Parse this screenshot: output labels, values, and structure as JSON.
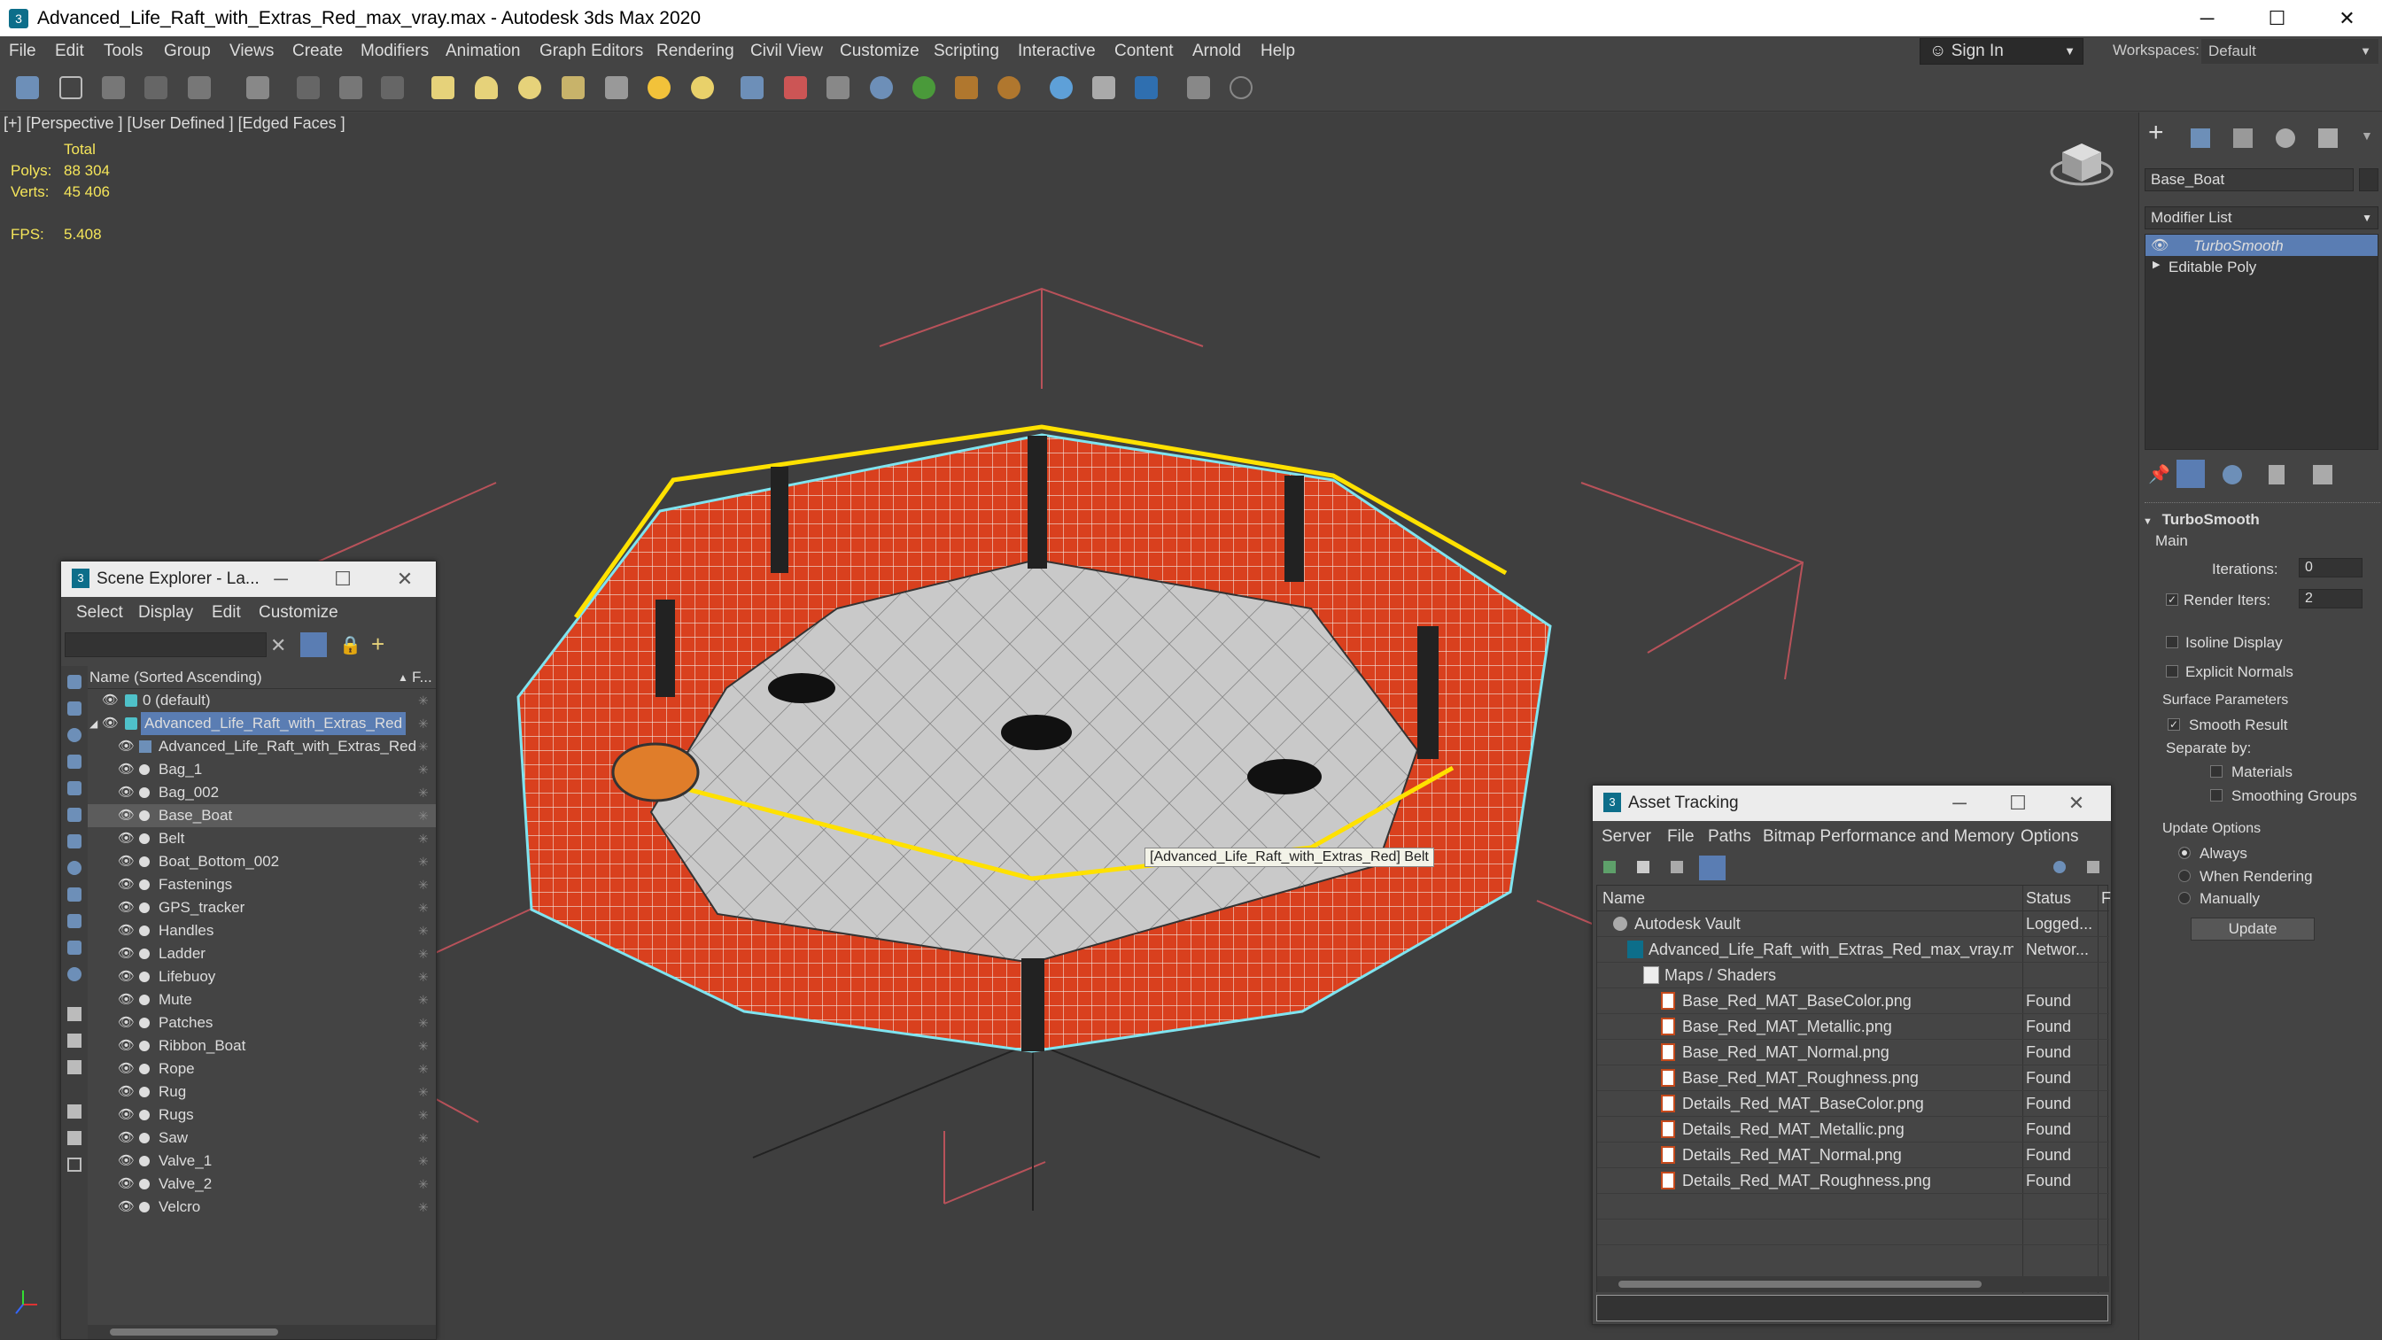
{
  "window": {
    "title": "Advanced_Life_Raft_with_Extras_Red_max_vray.max - Autodesk 3ds Max 2020",
    "minimize": "─",
    "maximize": "☐",
    "close": "✕"
  },
  "menu": [
    "File",
    "Edit",
    "Tools",
    "Group",
    "Views",
    "Create",
    "Modifiers",
    "Animation",
    "Graph Editors",
    "Rendering",
    "Civil View",
    "Customize",
    "Scripting",
    "Interactive",
    "Content",
    "Arnold",
    "Help"
  ],
  "signin": {
    "label": "Sign In",
    "arrow": "▼"
  },
  "workspaces": {
    "label": "Workspaces:",
    "value": "Default"
  },
  "viewport": {
    "label": "[+] [Perspective ] [User Defined ] [Edged Faces ]",
    "stats": {
      "total": "Total",
      "polys_label": "Polys:",
      "polys": "88 304",
      "verts_label": "Verts:",
      "verts": "45 406",
      "fps_label": "FPS:",
      "fps": "5.408"
    },
    "tooltip": "[Advanced_Life_Raft_with_Extras_Red] Belt"
  },
  "scene_explorer": {
    "title": "Scene Explorer - La...",
    "menu": [
      "Select",
      "Display",
      "Edit",
      "Customize"
    ],
    "column": "Name (Sorted Ascending)",
    "col2": "F...",
    "rows": [
      {
        "name": "0 (default)",
        "level": 0,
        "kind": "layer"
      },
      {
        "name": "Advanced_Life_Raft_with_Extras_Red",
        "level": 0,
        "kind": "layer-sel"
      },
      {
        "name": "Advanced_Life_Raft_with_Extras_Red",
        "level": 1,
        "kind": "group"
      },
      {
        "name": "Bag_1",
        "level": 1,
        "kind": "obj"
      },
      {
        "name": "Bag_002",
        "level": 1,
        "kind": "obj"
      },
      {
        "name": "Base_Boat",
        "level": 1,
        "kind": "obj-sel"
      },
      {
        "name": "Belt",
        "level": 1,
        "kind": "obj"
      },
      {
        "name": "Boat_Bottom_002",
        "level": 1,
        "kind": "obj"
      },
      {
        "name": "Fastenings",
        "level": 1,
        "kind": "obj"
      },
      {
        "name": "GPS_tracker",
        "level": 1,
        "kind": "obj"
      },
      {
        "name": "Handles",
        "level": 1,
        "kind": "obj"
      },
      {
        "name": "Ladder",
        "level": 1,
        "kind": "obj"
      },
      {
        "name": "Lifebuoy",
        "level": 1,
        "kind": "obj"
      },
      {
        "name": "Mute",
        "level": 1,
        "kind": "obj"
      },
      {
        "name": "Patches",
        "level": 1,
        "kind": "obj"
      },
      {
        "name": "Ribbon_Boat",
        "level": 1,
        "kind": "obj"
      },
      {
        "name": "Rope",
        "level": 1,
        "kind": "obj"
      },
      {
        "name": "Rug",
        "level": 1,
        "kind": "obj"
      },
      {
        "name": "Rugs",
        "level": 1,
        "kind": "obj"
      },
      {
        "name": "Saw",
        "level": 1,
        "kind": "obj"
      },
      {
        "name": "Valve_1",
        "level": 1,
        "kind": "obj"
      },
      {
        "name": "Valve_2",
        "level": 1,
        "kind": "obj"
      },
      {
        "name": "Velcro",
        "level": 1,
        "kind": "obj"
      }
    ]
  },
  "asset_tracking": {
    "title": "Asset Tracking",
    "menu": [
      "Server",
      "File",
      "Paths",
      "Bitmap Performance and Memory",
      "Options"
    ],
    "col_name": "Name",
    "col_status": "Status",
    "col3": "F",
    "rows": [
      {
        "name": "Autodesk Vault",
        "status": "Logged...",
        "kind": "vault"
      },
      {
        "name": "Advanced_Life_Raft_with_Extras_Red_max_vray.max",
        "status": "Networ...",
        "kind": "max"
      },
      {
        "name": "Maps / Shaders",
        "status": "",
        "kind": "folder"
      },
      {
        "name": "Base_Red_MAT_BaseColor.png",
        "status": "Found",
        "kind": "png"
      },
      {
        "name": "Base_Red_MAT_Metallic.png",
        "status": "Found",
        "kind": "png"
      },
      {
        "name": "Base_Red_MAT_Normal.png",
        "status": "Found",
        "kind": "png"
      },
      {
        "name": "Base_Red_MAT_Roughness.png",
        "status": "Found",
        "kind": "png"
      },
      {
        "name": "Details_Red_MAT_BaseColor.png",
        "status": "Found",
        "kind": "png"
      },
      {
        "name": "Details_Red_MAT_Metallic.png",
        "status": "Found",
        "kind": "png"
      },
      {
        "name": "Details_Red_MAT_Normal.png",
        "status": "Found",
        "kind": "png"
      },
      {
        "name": "Details_Red_MAT_Roughness.png",
        "status": "Found",
        "kind": "png"
      }
    ]
  },
  "command_panel": {
    "object_name": "Base_Boat",
    "modifier_list": "Modifier List",
    "stack": [
      "TurboSmooth",
      "Editable Poly"
    ],
    "rollout": "TurboSmooth",
    "main": "Main",
    "iterations_label": "Iterations:",
    "iterations": "0",
    "render_iters_label": "Render Iters:",
    "render_iters": "2",
    "isoline": "Isoline Display",
    "explicit": "Explicit Normals",
    "surface_params": "Surface Parameters",
    "smooth_result": "Smooth Result",
    "separate_by": "Separate by:",
    "materials": "Materials",
    "smoothing_groups": "Smoothing Groups",
    "update_options": "Update Options",
    "always": "Always",
    "when_rendering": "When Rendering",
    "manually": "Manually",
    "update_button": "Update"
  },
  "colors": {
    "selection_blue": "#5a7db3",
    "raft_red": "#d9401e",
    "stat_yellow": "#f5e55a",
    "wire_cyan": "#7fe4f0"
  }
}
